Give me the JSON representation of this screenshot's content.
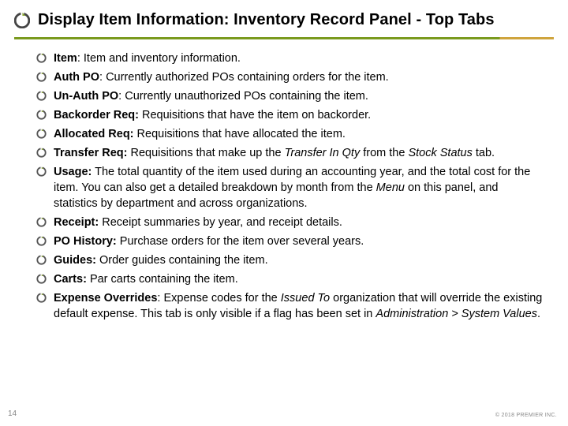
{
  "title": "Display Item Information: Inventory Record Panel - Top Tabs",
  "page_number": "14",
  "copyright": "© 2018 PREMIER INC.",
  "bullets": [
    {
      "term": "Item",
      "sep": ": ",
      "desc_pre": "Item and inventory information.",
      "italics": [],
      "desc_post": ""
    },
    {
      "term": "Auth PO",
      "sep": ": ",
      "desc_pre": "Currently authorized POs containing orders for the item.",
      "italics": [],
      "desc_post": ""
    },
    {
      "term": "Un-Auth PO",
      "sep": ": ",
      "desc_pre": "Currently unauthorized POs containing the item.",
      "italics": [],
      "desc_post": ""
    },
    {
      "term": "Backorder Req:",
      "sep": " ",
      "desc_pre": "Requisitions that have the item on backorder.",
      "italics": [],
      "desc_post": ""
    },
    {
      "term": "Allocated Req:",
      "sep": " ",
      "desc_pre": "Requisitions that have allocated the item.",
      "italics": [],
      "desc_post": ""
    },
    {
      "term": "Transfer Req:",
      "sep": " ",
      "desc_pre": "Requisitions that make up the ",
      "italics": [
        "Transfer In Qty",
        " from the ",
        "Stock Status"
      ],
      "desc_post": " tab."
    },
    {
      "term": "Usage:",
      "sep": " ",
      "desc_pre": "The total quantity of the item used during an accounting year, and the total cost for the item. You can also get a detailed breakdown by month from the ",
      "italics": [
        "Menu"
      ],
      "desc_post": " on this panel, and statistics by department and across organizations."
    },
    {
      "term": "Receipt:",
      "sep": " ",
      "desc_pre": "Receipt summaries by year, and receipt details.",
      "italics": [],
      "desc_post": ""
    },
    {
      "term": "PO History:",
      "sep": " ",
      "desc_pre": "Purchase orders for the item over several years.",
      "italics": [],
      "desc_post": ""
    },
    {
      "term": "Guides:",
      "sep": " ",
      "desc_pre": "Order guides containing the item.",
      "italics": [],
      "desc_post": ""
    },
    {
      "term": "Carts:",
      "sep": " ",
      "desc_pre": "Par carts containing the item.",
      "italics": [],
      "desc_post": ""
    },
    {
      "term": "Expense Overrides",
      "sep": ": ",
      "desc_pre": "Expense codes for the ",
      "italics": [
        "Issued To"
      ],
      "desc_post": " organization that will override the existing default expense. This tab is only visible if a flag has been set in ",
      "italics2": [
        "Administration > System Values"
      ],
      "desc_post2": "."
    }
  ]
}
